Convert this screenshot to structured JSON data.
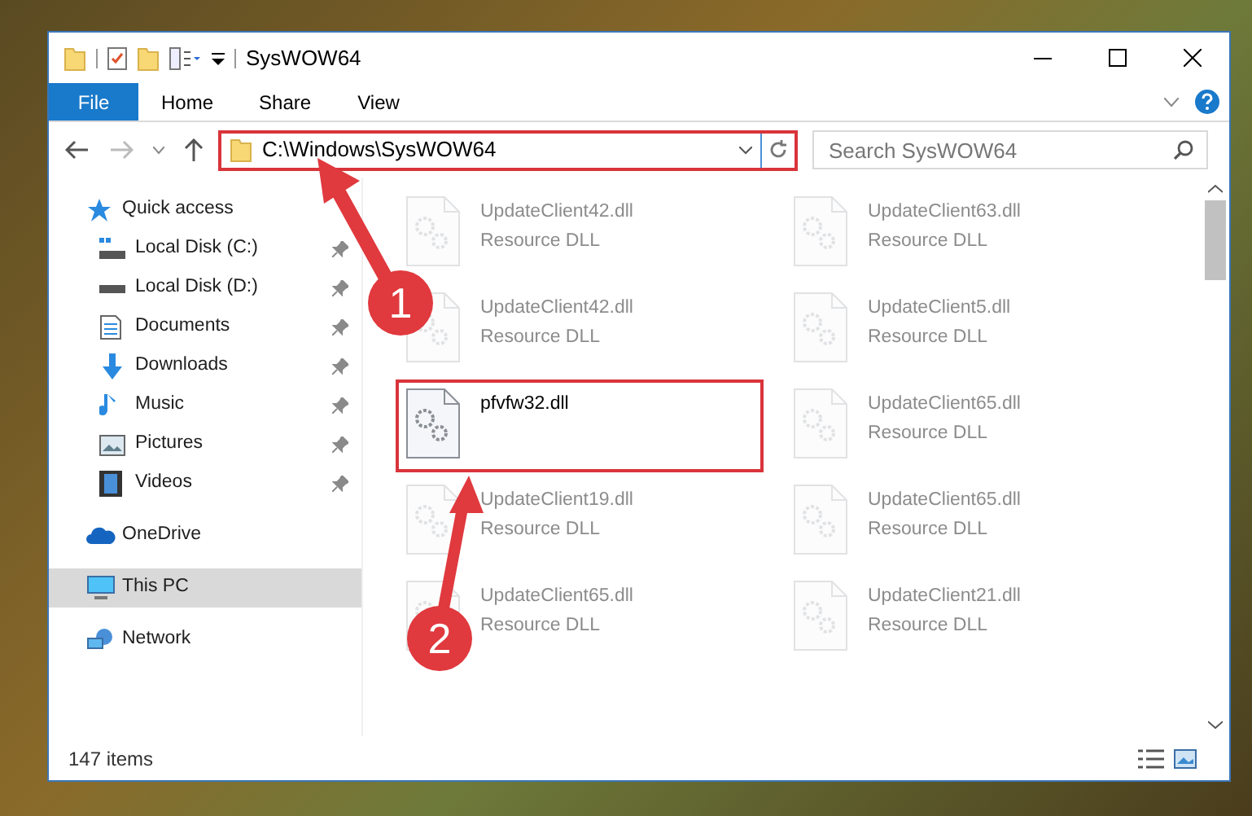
{
  "window": {
    "title": "SysWOW64"
  },
  "ribbon_tabs": [
    {
      "label": "File",
      "selected": true
    },
    {
      "label": "Home",
      "selected": false
    },
    {
      "label": "Share",
      "selected": false
    },
    {
      "label": "View",
      "selected": false
    }
  ],
  "address_bar": {
    "path": "C:\\Windows\\SysWOW64",
    "highlighted": true
  },
  "search": {
    "placeholder": "Search SysWOW64"
  },
  "sidebar": {
    "items": [
      {
        "label": "Quick access",
        "selected": false,
        "children": [
          {
            "label": "Local Disk (C:)",
            "pinned": true
          },
          {
            "label": "Local Disk (D:)",
            "pinned": true
          },
          {
            "label": "Documents",
            "pinned": true
          },
          {
            "label": "Downloads",
            "pinned": true
          },
          {
            "label": "Music",
            "pinned": true
          },
          {
            "label": "Pictures",
            "pinned": true
          },
          {
            "label": "Videos",
            "pinned": true
          }
        ]
      },
      {
        "label": "OneDrive",
        "selected": false
      },
      {
        "label": "This PC",
        "selected": true
      },
      {
        "label": "Network",
        "selected": false
      }
    ]
  },
  "files": {
    "columns": [
      [
        {
          "name": "UpdateClient42.dll",
          "type": "Resource DLL",
          "faded": true,
          "highlighted": false
        },
        {
          "name": "UpdateClient42.dll",
          "type": "Resource DLL",
          "faded": true,
          "highlighted": false
        },
        {
          "name": "pfvfw32.dll",
          "faded": false,
          "highlighted": true
        },
        {
          "name": "UpdateClient19.dll",
          "type": "Resource DLL",
          "faded": true,
          "highlighted": false
        },
        {
          "name": "UpdateClient65.dll",
          "type": "Resource DLL",
          "faded": true,
          "highlighted": false
        }
      ],
      [
        {
          "name": "UpdateClient63.dll",
          "type": "Resource DLL",
          "faded": true,
          "highlighted": false
        },
        {
          "name": "UpdateClient5.dll",
          "type": "Resource DLL",
          "faded": true,
          "highlighted": false
        },
        {
          "name": "UpdateClient65.dll",
          "type": "Resource DLL",
          "faded": true,
          "highlighted": false
        },
        {
          "name": "UpdateClient65.dll",
          "type": "Resource DLL",
          "faded": true,
          "highlighted": false
        },
        {
          "name": "UpdateClient21.dll",
          "type": "Resource DLL",
          "faded": true,
          "highlighted": false
        }
      ]
    ]
  },
  "status_bar": {
    "item_count": "147 items"
  },
  "annotations": [
    {
      "label": "1"
    },
    {
      "label": "2"
    }
  ]
}
